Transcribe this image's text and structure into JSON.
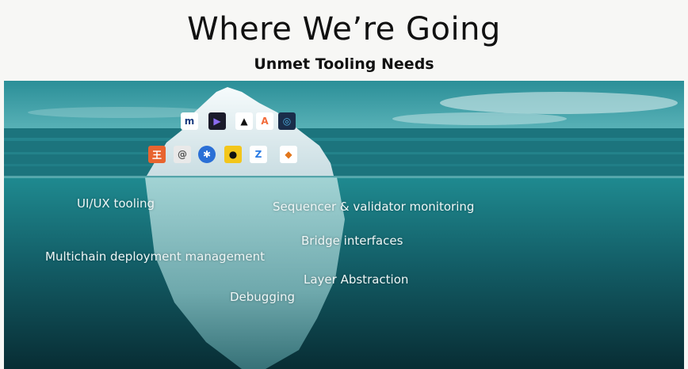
{
  "slide": {
    "title": "Where We’re Going",
    "subtitle": "Unmet Tooling Needs"
  },
  "colors": {
    "sky_top": "#2a8a94",
    "sea_surface": "#1f7d86",
    "deep_water": "#0b3a42",
    "ice": "#e6eef0"
  },
  "logos": [
    {
      "icon": "round-m-logo-icon"
    },
    {
      "icon": "play-triangle-logo-icon"
    },
    {
      "icon": "triangle-a-logo-icon"
    },
    {
      "icon": "orange-a-sparkle-logo-icon"
    },
    {
      "icon": "circle-target-logo-icon"
    },
    {
      "icon": "red-square-logo-icon"
    },
    {
      "icon": "spiral-logo-icon"
    },
    {
      "icon": "blue-gear-logo-icon"
    },
    {
      "icon": "yellow-helmet-logo-icon"
    },
    {
      "icon": "z-logo-icon"
    },
    {
      "icon": "fox-logo-icon"
    }
  ],
  "labels": {
    "ui_ux": "UI/UX tooling",
    "sequencer": "Sequencer & validator monitoring",
    "bridge": "Bridge interfaces",
    "multichain": "Multichain deployment management",
    "layer": "Layer Abstraction",
    "debugging": "Debugging"
  }
}
